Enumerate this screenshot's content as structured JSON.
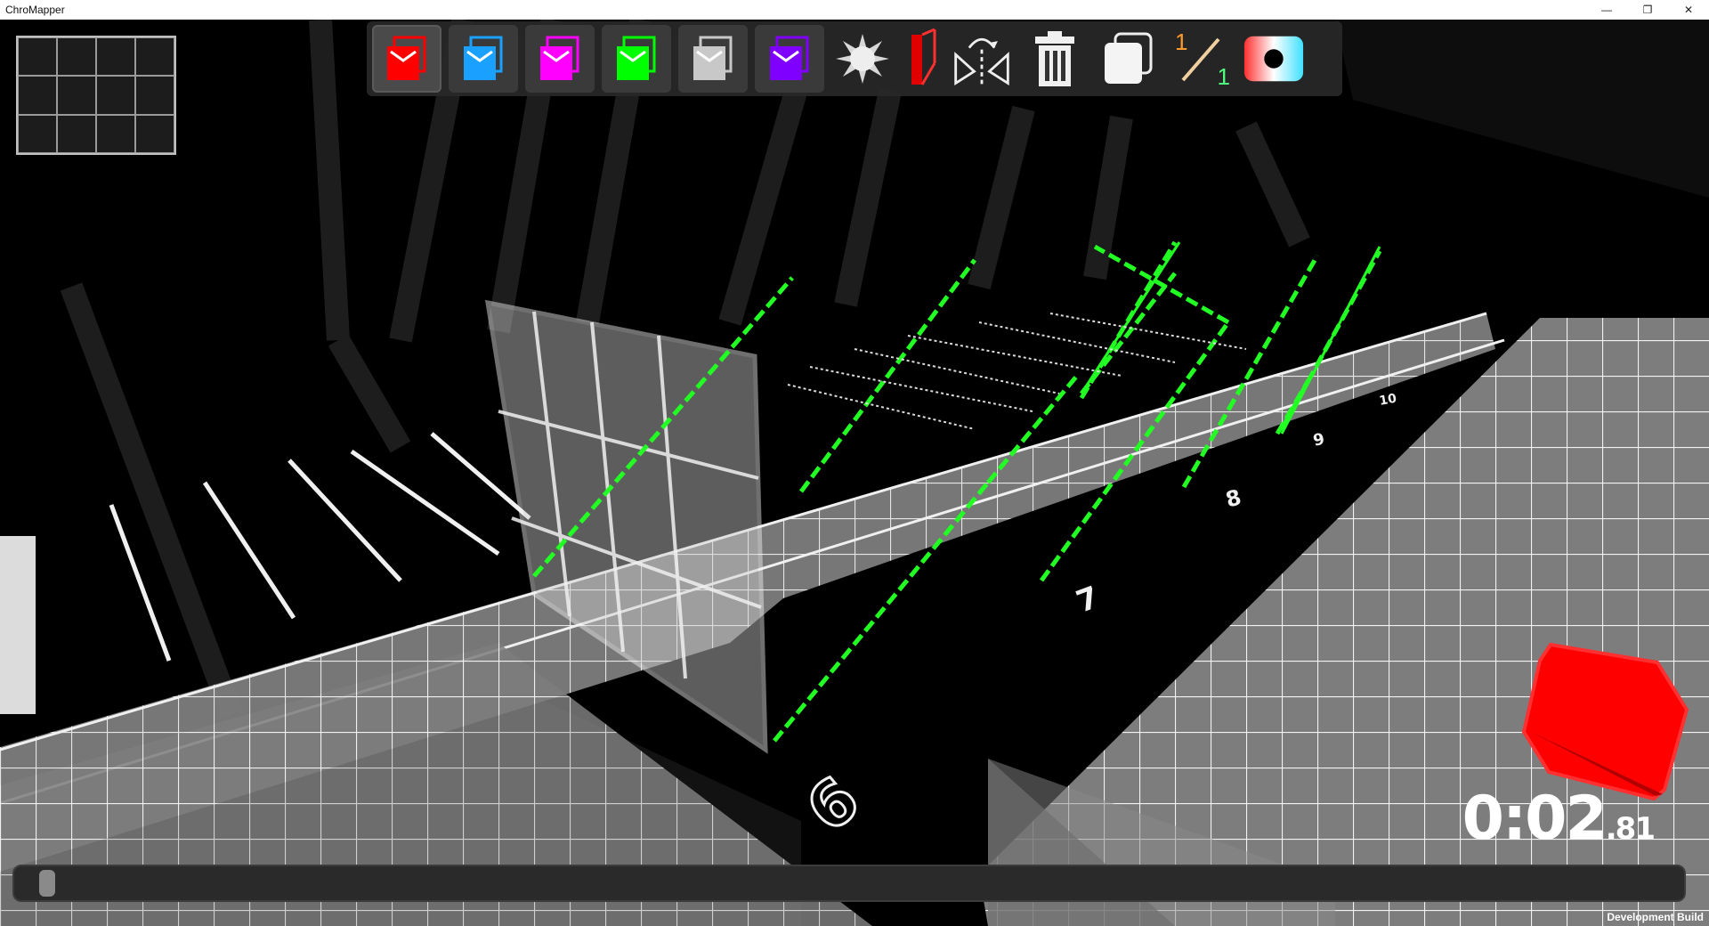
{
  "window": {
    "title": "ChroMapper",
    "minimize": "—",
    "restore": "❐",
    "close": "✕"
  },
  "toolbar": {
    "note_colors": [
      "#ff0000",
      "#1aa0ff",
      "#ff00ff",
      "#00ff00",
      "#c8c8c8",
      "#8000ff"
    ],
    "selected_index": 0,
    "fraction_top": "1",
    "fraction_bottom": "1"
  },
  "grid_labels": {
    "beat_6": "6",
    "beat_7": "7",
    "beat_8": "8",
    "beat_9": "9",
    "beat_10": "10"
  },
  "timer": {
    "main": "0:02",
    "fraction": ".81"
  },
  "footer": {
    "development_build": "Development Build"
  },
  "scene": {
    "chain_color": "#22ff22",
    "selected_block_color": "#ff0000"
  }
}
